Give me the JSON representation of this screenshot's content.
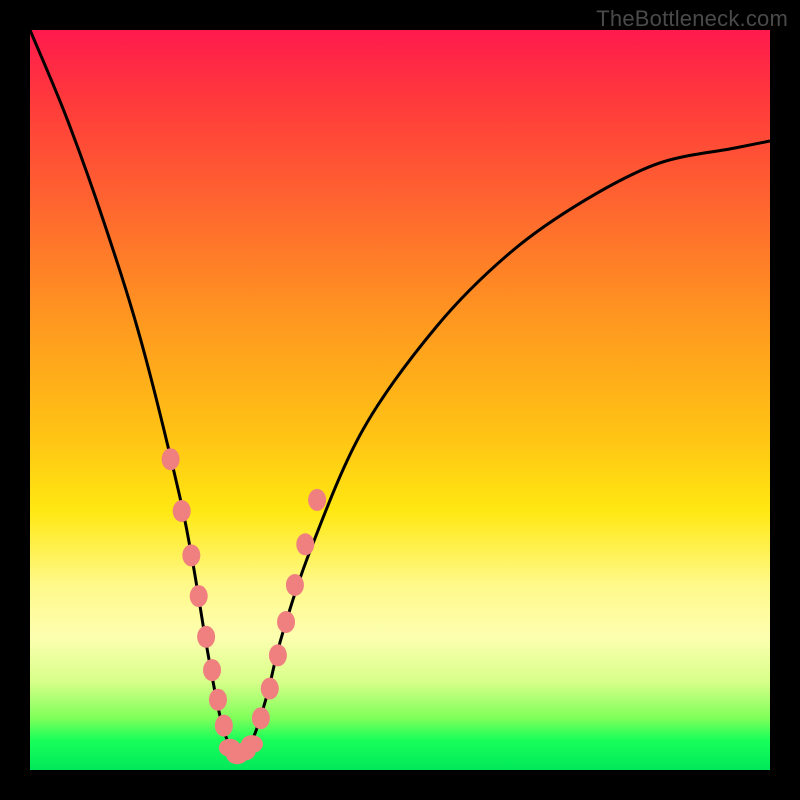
{
  "watermark": "TheBottleneck.com",
  "colors": {
    "frame": "#000000",
    "marker": "#f08080",
    "curve": "#000000",
    "gradient_stops": [
      "#ff1a4d",
      "#ff3b3b",
      "#ff6a2e",
      "#ff9a1f",
      "#ffc414",
      "#ffe812",
      "#fff98a",
      "#fdffb0",
      "#d8ff8a",
      "#7fff5a",
      "#18ff5a",
      "#00e85a"
    ]
  },
  "chart_data": {
    "type": "line",
    "title": "",
    "xlabel": "",
    "ylabel": "",
    "xlim": [
      0,
      100
    ],
    "ylim": [
      0,
      100
    ],
    "description": "V-shaped bottleneck curve; minimum (~0%) near x≈28; curve rises steeply to ~100% at x=0 and ~85% at x=100. Background gradient red→green top→bottom indicates severity.",
    "series": [
      {
        "name": "bottleneck-curve",
        "x": [
          0,
          5,
          10,
          15,
          20,
          22,
          24,
          26,
          28,
          30,
          32,
          34,
          38,
          45,
          55,
          65,
          75,
          85,
          95,
          100
        ],
        "values": [
          100,
          88,
          74,
          58,
          38,
          28,
          16,
          6,
          2,
          4,
          10,
          18,
          30,
          46,
          60,
          70,
          77,
          82,
          84,
          85
        ]
      }
    ],
    "markers": {
      "name": "highlighted-points",
      "left_branch": {
        "x": [
          19.0,
          20.5,
          21.8,
          22.8,
          23.8,
          24.6,
          25.4,
          26.2
        ],
        "values": [
          42.0,
          35.0,
          29.0,
          23.5,
          18.0,
          13.5,
          9.5,
          6.0
        ]
      },
      "bottom": {
        "x": [
          27.0,
          28.0,
          29.0,
          30.0
        ],
        "values": [
          3.0,
          2.0,
          2.5,
          3.5
        ]
      },
      "right_branch": {
        "x": [
          31.2,
          32.4,
          33.5,
          34.6,
          35.8,
          37.2,
          38.8
        ],
        "values": [
          7.0,
          11.0,
          15.5,
          20.0,
          25.0,
          30.5,
          36.5
        ]
      }
    }
  }
}
